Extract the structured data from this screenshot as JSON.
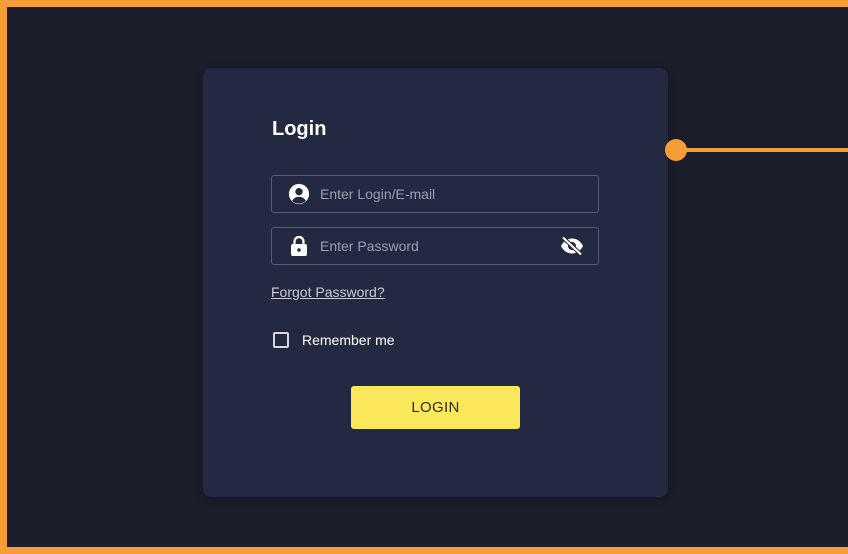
{
  "form": {
    "title": "Login",
    "login_field": {
      "placeholder": "Enter Login/E-mail",
      "value": "",
      "icon": "user-circle-icon"
    },
    "password_field": {
      "placeholder": "Enter Password",
      "value": "",
      "icon": "lock-icon",
      "toggle_icon": "eye-slash-icon"
    },
    "forgot_label": "Forgot Password?",
    "remember_label": "Remember me",
    "remember_checked": false,
    "submit_label": "LOGIN"
  },
  "colors": {
    "frame_border": "#f79d36",
    "page_background": "#1b1d2a",
    "card_background": "#232941",
    "button_background": "#fde85b",
    "connector": "#f79d36"
  }
}
